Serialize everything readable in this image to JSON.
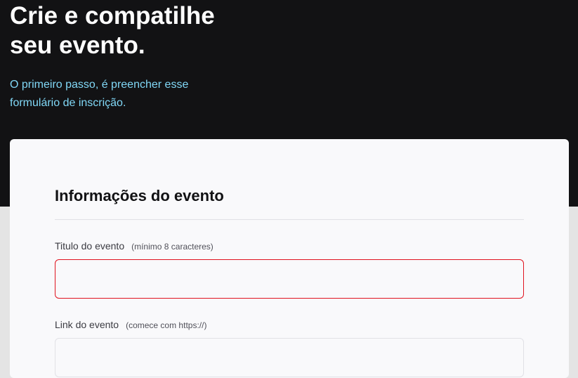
{
  "hero": {
    "title": "Crie e compatilhe seu evento.",
    "subtitle": "O primeiro passo, é preencher esse formulário de inscrição."
  },
  "form": {
    "section_title": "Informações do evento",
    "fields": [
      {
        "label": "Titulo do evento",
        "hint": "(mínimo 8 caracteres)",
        "value": "",
        "state": "error"
      },
      {
        "label": "Link do evento",
        "hint": "(comece com https://)",
        "value": "",
        "state": "normal"
      }
    ]
  },
  "colors": {
    "hero_background": "#121214",
    "subtitle": "#81d8f7",
    "error_border": "#e0131f",
    "card_background": "#f9f9fb"
  }
}
